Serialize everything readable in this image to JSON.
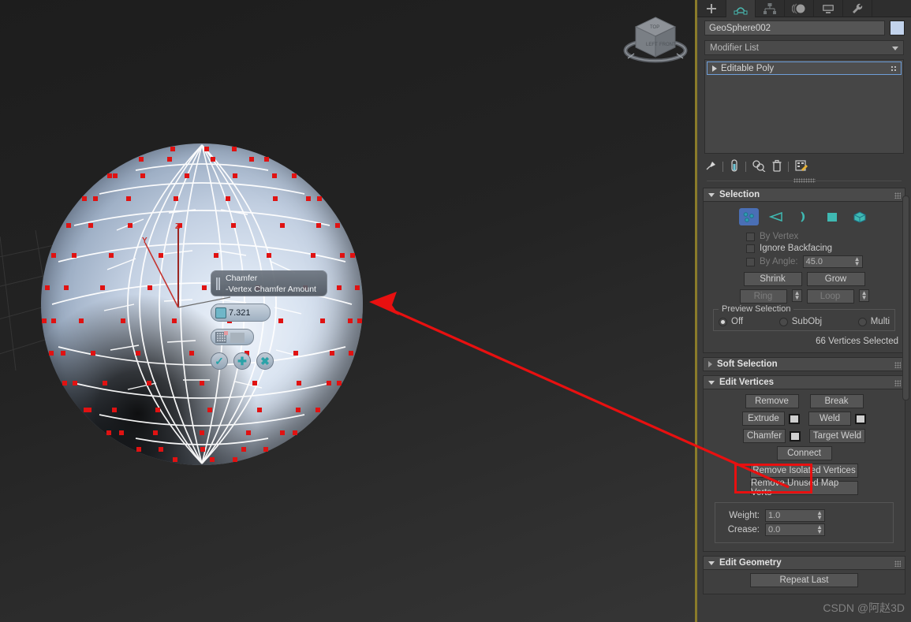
{
  "app": {
    "watermark": "CSDN @阿赵3D"
  },
  "viewport": {
    "gizmo": {
      "axis_z": "Z",
      "axis_y": "Y"
    },
    "caddy": {
      "title": "Chamfer",
      "subtitle": "-Vertex Chamfer Amount",
      "amount_value": "7.321",
      "ok_label": "✓",
      "apply_label": "✚",
      "cancel_label": "✖"
    },
    "viewcube": {
      "front_label": "FRONT",
      "left_label": "LEFT",
      "top_label": "TOP"
    }
  },
  "panel": {
    "tabs": [
      {
        "name": "create-tab",
        "icon": "plus-icon"
      },
      {
        "name": "modify-tab",
        "icon": "modify-curve-icon"
      },
      {
        "name": "hierarchy-tab",
        "icon": "hierarchy-icon"
      },
      {
        "name": "motion-tab",
        "icon": "motion-icon"
      },
      {
        "name": "display-tab",
        "icon": "display-icon"
      },
      {
        "name": "utilities-tab",
        "icon": "wrench-icon"
      }
    ],
    "object_name": "GeoSphere002",
    "color_swatch": "#c2d3ec",
    "modifier_list_label": "Modifier List",
    "stack": [
      {
        "label": "Editable Poly"
      }
    ],
    "stack_tools": [
      {
        "name": "pin-stack-icon"
      },
      {
        "name": "show-end-result-icon"
      },
      {
        "name": "make-unique-icon"
      },
      {
        "name": "remove-modifier-icon"
      },
      {
        "name": "configure-modifier-sets-icon"
      }
    ],
    "selection": {
      "title": "Selection",
      "subobject_modes": [
        {
          "name": "vertex",
          "active": true
        },
        {
          "name": "edge",
          "active": false
        },
        {
          "name": "border",
          "active": false
        },
        {
          "name": "polygon",
          "active": false
        },
        {
          "name": "element",
          "active": false
        }
      ],
      "by_vertex": "By Vertex",
      "ignore_backfacing": "Ignore Backfacing",
      "by_angle": "By Angle:",
      "by_angle_value": "45.0",
      "shrink": "Shrink",
      "grow": "Grow",
      "ring": "Ring",
      "loop": "Loop",
      "preview_group": "Preview Selection",
      "preview_off": "Off",
      "preview_subobj": "SubObj",
      "preview_multi": "Multi",
      "status": "66 Vertices Selected"
    },
    "soft_selection": {
      "title": "Soft Selection"
    },
    "edit_vertices": {
      "title": "Edit Vertices",
      "remove": "Remove",
      "break": "Break",
      "extrude": "Extrude",
      "weld": "Weld",
      "chamfer": "Chamfer",
      "target_weld": "Target Weld",
      "connect": "Connect",
      "remove_isolated": "Remove Isolated Vertices",
      "remove_unused": "Remove Unused Map Verts",
      "weight_label": "Weight:",
      "weight_value": "1.0",
      "crease_label": "Crease:",
      "crease_value": "0.0"
    },
    "edit_geometry": {
      "title": "Edit Geometry",
      "repeat_last": "Repeat Last"
    }
  }
}
